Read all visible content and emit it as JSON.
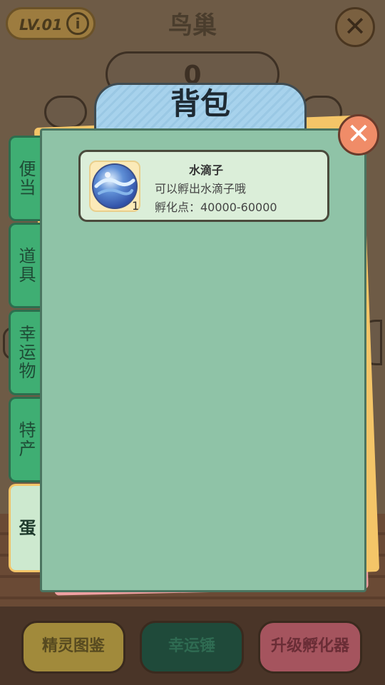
{
  "header": {
    "level": "LV.01",
    "info_icon": "i",
    "title": "鸟巢",
    "close": "✕",
    "counter": "0"
  },
  "modal": {
    "title": "背包",
    "close": "✕",
    "tabs": [
      {
        "label": "便当"
      },
      {
        "label": "道具"
      },
      {
        "label": "幸运物"
      },
      {
        "label": "特产"
      },
      {
        "label": "蛋"
      }
    ],
    "active_tab": "蛋",
    "items": [
      {
        "name": "水滴子",
        "description": "可以孵出水滴子哦",
        "hatch_points": "孵化点：40000-60000",
        "count": "1",
        "icon": "water-egg-icon"
      }
    ]
  },
  "bottom_buttons": {
    "guide": "精灵图鉴",
    "lucky_hammer": "幸运锤",
    "upgrade": "升级孵化器"
  },
  "colors": {
    "panel": "#8fc3a7",
    "tab": "#3fae73",
    "title_tab": "#a7d2ec",
    "close": "#f08c68"
  }
}
